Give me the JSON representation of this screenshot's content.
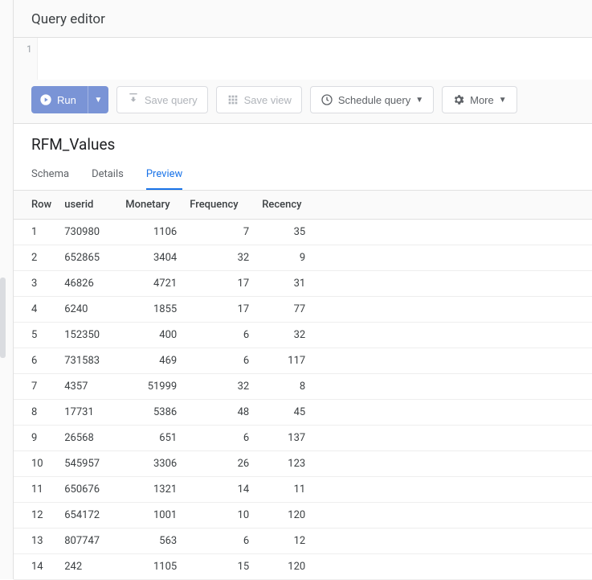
{
  "editor": {
    "title": "Query editor",
    "line_number": "1",
    "code": ""
  },
  "toolbar": {
    "run": "Run",
    "save_query": "Save query",
    "save_view": "Save view",
    "schedule_query": "Schedule query",
    "more": "More"
  },
  "table_name": "RFM_Values",
  "tabs": {
    "schema": "Schema",
    "details": "Details",
    "preview": "Preview"
  },
  "columns": {
    "row": "Row",
    "userid": "userid",
    "monetary": "Monetary",
    "frequency": "Frequency",
    "recency": "Recency"
  },
  "chart_data": {
    "type": "table",
    "columns": [
      "Row",
      "userid",
      "Monetary",
      "Frequency",
      "Recency"
    ],
    "rows": [
      {
        "row": "1",
        "userid": "730980",
        "monetary": "1106",
        "frequency": "7",
        "recency": "35"
      },
      {
        "row": "2",
        "userid": "652865",
        "monetary": "3404",
        "frequency": "32",
        "recency": "9"
      },
      {
        "row": "3",
        "userid": "46826",
        "monetary": "4721",
        "frequency": "17",
        "recency": "31"
      },
      {
        "row": "4",
        "userid": "6240",
        "monetary": "1855",
        "frequency": "17",
        "recency": "77"
      },
      {
        "row": "5",
        "userid": "152350",
        "monetary": "400",
        "frequency": "6",
        "recency": "32"
      },
      {
        "row": "6",
        "userid": "731583",
        "monetary": "469",
        "frequency": "6",
        "recency": "117"
      },
      {
        "row": "7",
        "userid": "4357",
        "monetary": "51999",
        "frequency": "32",
        "recency": "8"
      },
      {
        "row": "8",
        "userid": "17731",
        "monetary": "5386",
        "frequency": "48",
        "recency": "45"
      },
      {
        "row": "9",
        "userid": "26568",
        "monetary": "651",
        "frequency": "6",
        "recency": "137"
      },
      {
        "row": "10",
        "userid": "545957",
        "monetary": "3306",
        "frequency": "26",
        "recency": "123"
      },
      {
        "row": "11",
        "userid": "650676",
        "monetary": "1321",
        "frequency": "14",
        "recency": "11"
      },
      {
        "row": "12",
        "userid": "654172",
        "monetary": "1001",
        "frequency": "10",
        "recency": "120"
      },
      {
        "row": "13",
        "userid": "807747",
        "monetary": "563",
        "frequency": "6",
        "recency": "12"
      },
      {
        "row": "14",
        "userid": "242",
        "monetary": "1105",
        "frequency": "15",
        "recency": "120"
      }
    ]
  }
}
